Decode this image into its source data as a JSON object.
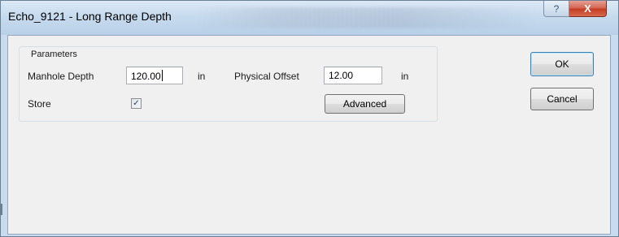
{
  "window": {
    "title": "Echo_9121 - Long Range Depth",
    "help_glyph": "?",
    "close_glyph": "X"
  },
  "parameters": {
    "legend": "Parameters",
    "manhole_depth_label": "Manhole Depth",
    "manhole_depth_value": "120.00",
    "manhole_depth_unit": "in",
    "physical_offset_label": "Physical Offset",
    "physical_offset_value": "12.00",
    "physical_offset_unit": "in",
    "store_label": "Store",
    "store_checked": true,
    "store_check_glyph": "✓",
    "advanced_label": "Advanced"
  },
  "buttons": {
    "ok_label": "OK",
    "cancel_label": "Cancel"
  },
  "colors": {
    "frame": "#c9dcef",
    "client": "#f0f0f0",
    "close_button": "#c43d24"
  }
}
